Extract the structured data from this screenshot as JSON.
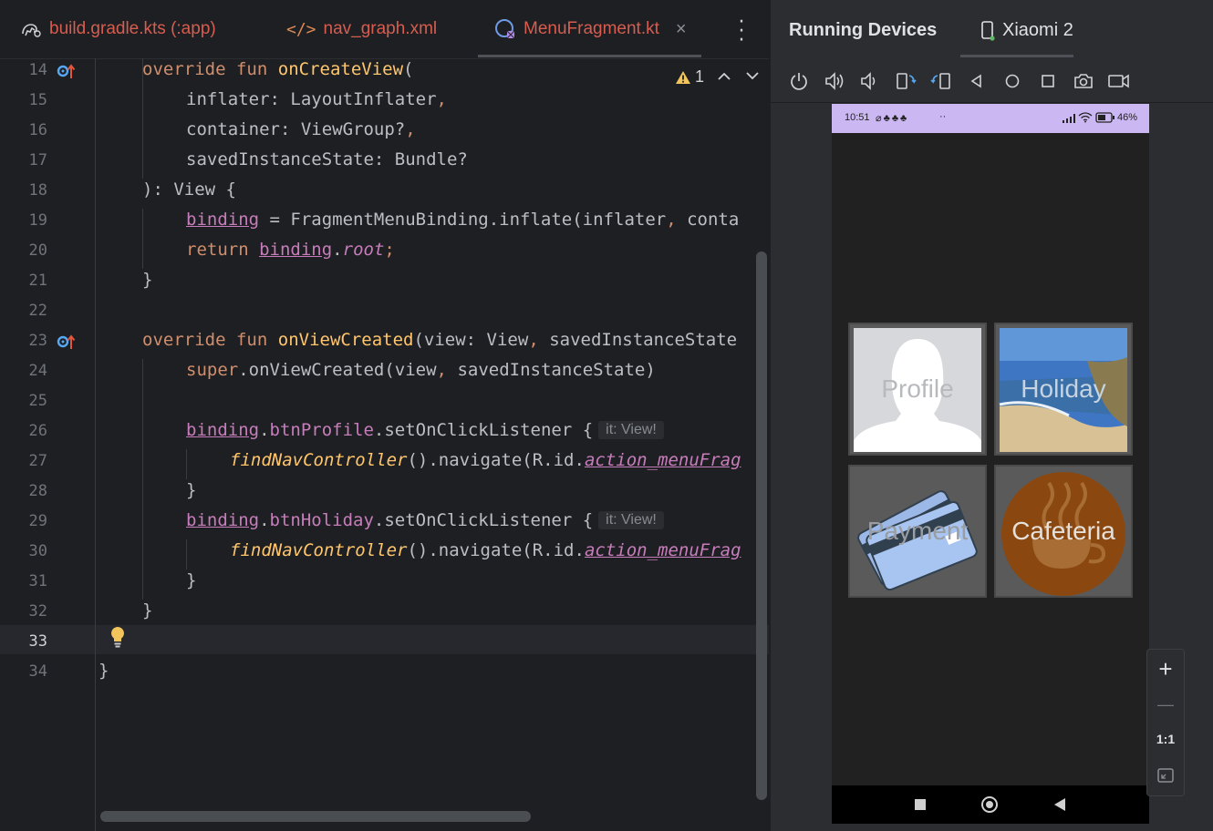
{
  "editor": {
    "tabs": [
      {
        "label": "build.gradle.kts (:app)"
      },
      {
        "label": "nav_graph.xml"
      },
      {
        "label": "MenuFragment.kt",
        "close": "×"
      }
    ],
    "warning_count": "1",
    "line_numbers": [
      "14",
      "15",
      "16",
      "17",
      "18",
      "19",
      "20",
      "21",
      "22",
      "23",
      "24",
      "25",
      "26",
      "27",
      "28",
      "29",
      "30",
      "31",
      "32",
      "33",
      "34"
    ],
    "current_line": "33",
    "code": {
      "l14_a": "override",
      "l14_b": "fun",
      "l14_c": "onCreateView",
      "l14_d": "(",
      "l15_a": "inflater: LayoutInflater",
      "l15_b": ",",
      "l16_a": "container: ViewGroup?",
      "l16_b": ",",
      "l17_a": "savedInstanceState: Bundle?",
      "l18_a": "): View {",
      "l19_a": "binding",
      "l19_b": " = FragmentMenuBinding.inflate(inflater",
      "l19_c": ",",
      "l19_d": " conta",
      "l20_a": "return",
      "l20_b": "binding",
      "l20_c": ".",
      "l20_d": "root",
      "l20_e": ";",
      "l21_a": "}",
      "l23_a": "override",
      "l23_b": "fun",
      "l23_c": "onViewCreated",
      "l23_d": "(view: View",
      "l23_e": ",",
      "l23_f": " savedInstanceState",
      "l24_a": "super",
      "l24_b": ".onViewCreated(view",
      "l24_c": ",",
      "l24_d": " savedInstanceState)",
      "l26_a": "binding",
      "l26_b": ".",
      "l26_c": "btnProfile",
      "l26_d": ".setOnClickListener {",
      "l26_hint": "it: View!",
      "l27_a": "findNavController",
      "l27_b": "().navigate(R.id.",
      "l27_c": "action_menuFrag",
      "l28_a": "}",
      "l29_a": "binding",
      "l29_b": ".",
      "l29_c": "btnHoliday",
      "l29_d": ".setOnClickListener {",
      "l29_hint": "it: View!",
      "l30_a": "findNavController",
      "l30_b": "().navigate(R.id.",
      "l30_c": "action_menuFrag",
      "l31_a": "}",
      "l32_a": "}",
      "l34_a": "}"
    }
  },
  "running_devices": {
    "title": "Running Devices",
    "device_tab": "Xiaomi 2",
    "toolbar_icons": [
      "power-icon",
      "volume-up-icon",
      "volume-down-icon",
      "rotate-left-icon",
      "rotate-right-icon",
      "back-icon",
      "home-icon",
      "overview-icon",
      "screenshot-icon",
      "screen-record-icon"
    ],
    "status": {
      "time": "10:51",
      "dots": "··",
      "battery": "46%"
    },
    "tiles": [
      {
        "label": "Profile"
      },
      {
        "label": "Holiday"
      },
      {
        "label": "Payment"
      },
      {
        "label": "Cafeteria"
      }
    ],
    "zoom": {
      "in": "+",
      "out": "—",
      "actual": "1:1"
    }
  },
  "colors": {
    "keyword": "#cf8e6d",
    "function_decl": "#ffc66d",
    "property": "#c77dbb",
    "tab_text": "#d65d4f",
    "status_bar": "#cbb7f2"
  }
}
